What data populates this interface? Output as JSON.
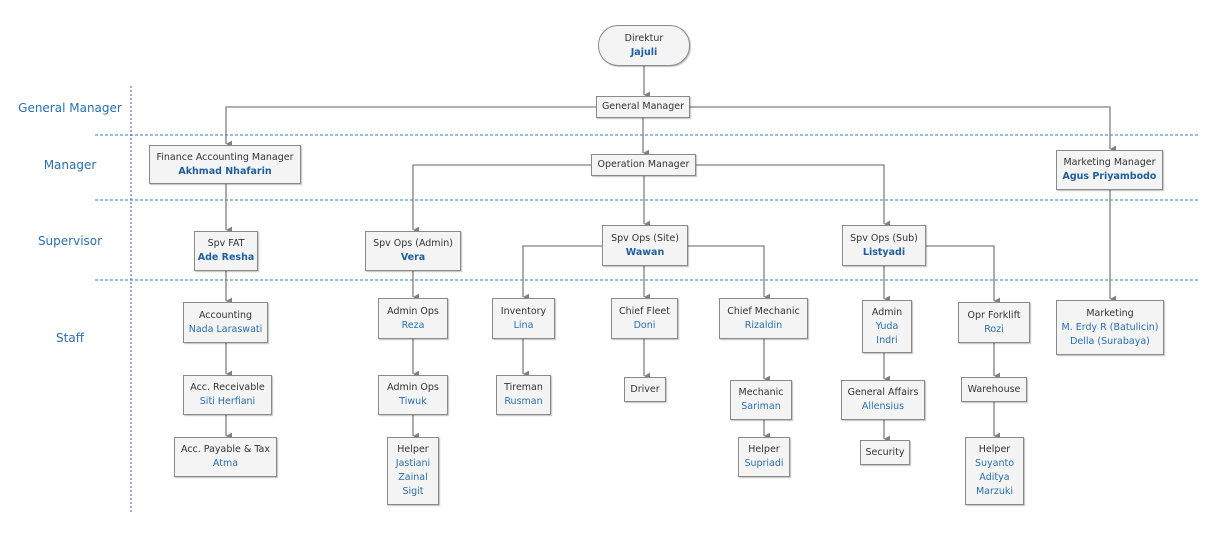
{
  "lanes": [
    "General Manager",
    "Manager",
    "Supervisor",
    "Staff"
  ],
  "nodes": {
    "direktur": {
      "title": "Direktur",
      "name": "Jajuli"
    },
    "gm": {
      "title": "General Manager"
    },
    "fam": {
      "title": "Finance Accounting Manager",
      "name": "Akhmad Nhafarin"
    },
    "opm": {
      "title": "Operation Manager"
    },
    "mkm": {
      "title": "Marketing Manager",
      "name": "Agus Priyambodo"
    },
    "spv_fat": {
      "title": "Spv FAT",
      "name": "Ade Resha"
    },
    "spv_admin": {
      "title": "Spv Ops (Admin)",
      "name": "Vera"
    },
    "spv_site": {
      "title": "Spv Ops (Site)",
      "name": "Wawan"
    },
    "spv_sub": {
      "title": "Spv Ops (Sub)",
      "name": "Listyadi"
    },
    "accounting": {
      "title": "Accounting",
      "names": [
        "Nada Laraswati"
      ]
    },
    "acc_rec": {
      "title": "Acc. Receivable",
      "names": [
        "Siti Herfiani"
      ]
    },
    "acc_pay": {
      "title": "Acc. Payable & Tax",
      "names": [
        "Atma"
      ]
    },
    "admin_ops1": {
      "title": "Admin Ops",
      "names": [
        "Reza"
      ]
    },
    "admin_ops2": {
      "title": "Admin Ops",
      "names": [
        "Tiwuk"
      ]
    },
    "helper1": {
      "title": "Helper",
      "names": [
        "Jastiani",
        "Zainal",
        "Sigit"
      ]
    },
    "inventory": {
      "title": "Inventory",
      "names": [
        "Lina"
      ]
    },
    "tireman": {
      "title": "Tireman",
      "names": [
        "Rusman"
      ]
    },
    "chief_fleet": {
      "title": "Chief Fleet",
      "names": [
        "Doni"
      ]
    },
    "driver": {
      "title": "Driver"
    },
    "chief_mech": {
      "title": "Chief Mechanic",
      "names": [
        "Rizaldin"
      ]
    },
    "mechanic": {
      "title": "Mechanic",
      "names": [
        "Sariman"
      ]
    },
    "helper2": {
      "title": "Helper",
      "names": [
        "Supriadi"
      ]
    },
    "admin": {
      "title": "Admin",
      "names": [
        "Yuda",
        "Indri"
      ]
    },
    "ga": {
      "title": "General Affairs",
      "names": [
        "Allensius"
      ]
    },
    "security": {
      "title": "Security"
    },
    "forklift": {
      "title": "Opr Forklift",
      "names": [
        "Rozi"
      ]
    },
    "warehouse": {
      "title": "Warehouse"
    },
    "helper3": {
      "title": "Helper",
      "names": [
        "Suyanto",
        "Aditya",
        "Marzuki"
      ]
    },
    "marketing": {
      "title": "Marketing",
      "names": [
        "M. Erdy R (Batulicin)",
        "Della (Surabaya)"
      ]
    }
  },
  "colors": {
    "lane_label": "#2a6fae",
    "name_text": "#2a6fae",
    "connector": "#808080",
    "lane_divider": "#2a7fbf",
    "lane_axis": "#5050c0"
  }
}
